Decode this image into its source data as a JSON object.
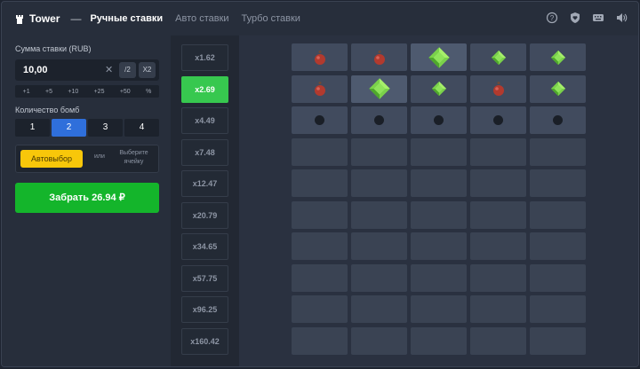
{
  "header": {
    "title": "Tower",
    "separator": "—",
    "modes": [
      {
        "label": "Ручные ставки",
        "active": true
      },
      {
        "label": "Авто ставки",
        "active": false
      },
      {
        "label": "Турбо ставки",
        "active": false
      }
    ],
    "icons": [
      "help-icon",
      "shield-heart-icon",
      "keyboard-icon",
      "sound-icon"
    ]
  },
  "bet": {
    "label": "Сумма ставки (RUB)",
    "value": "10,00",
    "clear": "✕",
    "half": "/2",
    "double": "X2",
    "quick": [
      "+1",
      "+5",
      "+10",
      "+25",
      "+50",
      "%"
    ]
  },
  "bombs": {
    "label": "Количество бомб",
    "options": [
      "1",
      "2",
      "3",
      "4"
    ],
    "selected": "2"
  },
  "auto": {
    "button": "Автовыбор",
    "or": "или",
    "pick": "Выберите ячейку"
  },
  "cashout": {
    "label": "Забрать 26.94 ₽"
  },
  "multipliers": [
    "x1.62",
    "x2.69",
    "x4.49",
    "x7.48",
    "x12.47",
    "x20.79",
    "x34.65",
    "x57.75",
    "x96.25",
    "x160.42"
  ],
  "active_multiplier": "x2.69",
  "grid": {
    "rows": [
      [
        "bomb",
        "bomb",
        "gem-big",
        "gem",
        "gem"
      ],
      [
        "bomb",
        "gem-big",
        "gem",
        "bomb",
        "gem"
      ],
      [
        "dot",
        "dot",
        "dot",
        "dot",
        "dot"
      ],
      [
        "",
        "",
        "",
        "",
        ""
      ],
      [
        "",
        "",
        "",
        "",
        ""
      ],
      [
        "",
        "",
        "",
        "",
        ""
      ],
      [
        "",
        "",
        "",
        "",
        ""
      ],
      [
        "",
        "",
        "",
        "",
        ""
      ],
      [
        "",
        "",
        "",
        "",
        ""
      ],
      [
        "",
        "",
        "",
        "",
        ""
      ]
    ]
  },
  "colors": {
    "accent_blue": "#2f6fdb",
    "yellow": "#f8c70a",
    "green": "#14b52b",
    "multiplier_active": "#37c84f"
  }
}
